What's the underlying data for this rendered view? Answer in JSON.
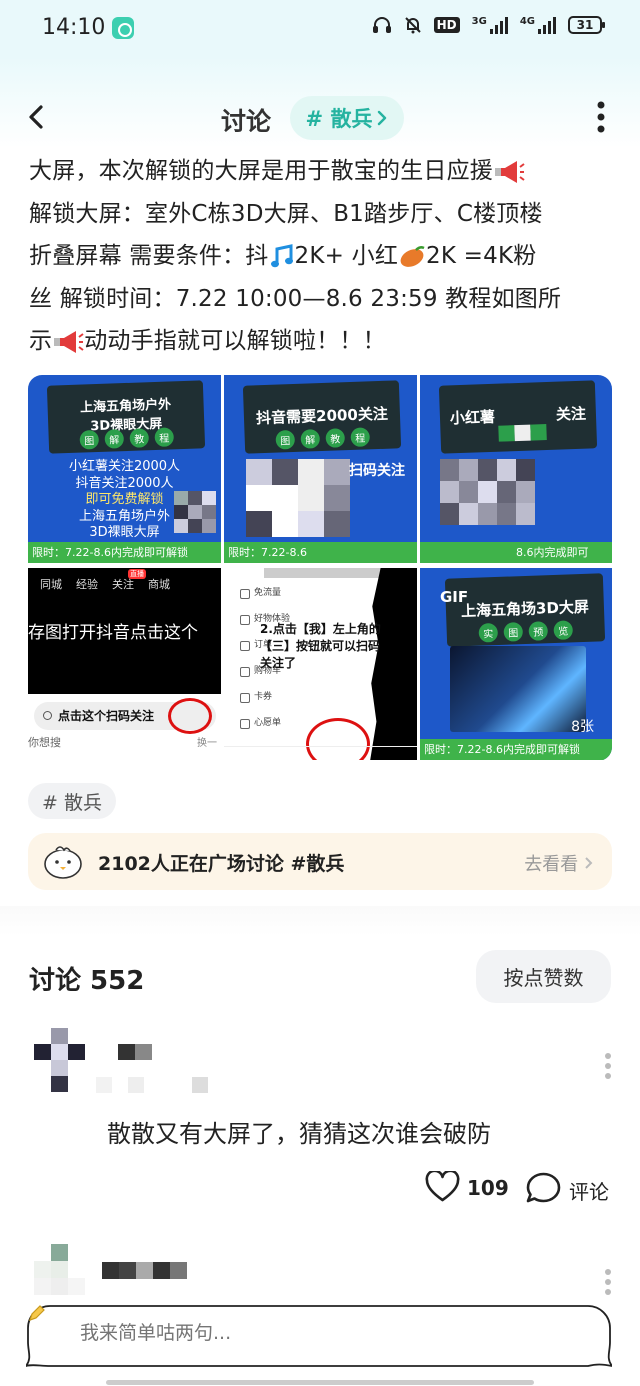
{
  "status_bar": {
    "time": "14:10",
    "hd_label": "HD",
    "net1": "3G",
    "net2": "4G",
    "battery": "31"
  },
  "header": {
    "title": "讨论",
    "topic_chip": "# 散兵"
  },
  "post": {
    "line1": "大屏，本次解锁的大屏是用于散宝的生日应援",
    "line2": "解锁大屏：室外C栋3D大屏、B1踏步厅、C楼顶楼",
    "line3_a": "折叠屏幕 需要条件：抖",
    "line3_b": "2K+ 小红",
    "line3_c": "2K =4K粉",
    "line4": "丝 解锁时间：7.22 10:00—8.6 23:59 教程如图所",
    "line5_a": "示",
    "line5_b": "动动手指就可以解锁啦！！！"
  },
  "images": {
    "tile1": {
      "title_l1": "上海五角场户外",
      "title_l2": "3D裸眼大屏",
      "chips": [
        "图",
        "解",
        "教",
        "程"
      ],
      "text_l1": "小红薯关注2000人",
      "text_l2": "抖音关注2000人",
      "text_l3": "即可免费解锁",
      "text_l4": "上海五角场户外",
      "text_l5": "3D裸眼大屏",
      "deadline": "限时：7.22-8.6内完成即可解锁"
    },
    "tile2": {
      "title": "抖音需要2000关注",
      "chips": [
        "图",
        "解",
        "教",
        "程"
      ],
      "scan": "扫码关注",
      "deadline": "限时：7.22-8.6"
    },
    "tile3": {
      "title_a": "小红薯",
      "title_b": "关注",
      "deadline": "8.6内完成即可"
    },
    "tile4": {
      "tabs": [
        "同城",
        "经验",
        "关注",
        "商城"
      ],
      "title": "存图打开抖音点击这个",
      "search": "点击这个扫码关注",
      "bottom": "你想搜",
      "bottom_right": "换一"
    },
    "tile5": {
      "menu": [
        "免流量",
        "好物体验",
        "订单",
        "购物车",
        "卡券",
        "心愿单"
      ],
      "step": "2.点击【我】左上角的【三】按钮就可以扫码关注了"
    },
    "tile6": {
      "gif": "GIF",
      "title": "上海五角场3D大屏",
      "chips": [
        "实",
        "图",
        "预",
        "览"
      ],
      "count": "8张",
      "deadline": "限时：7.22-8.6内完成即可解锁"
    }
  },
  "hashtag_chip": "# 散兵",
  "plaza": {
    "text": "2102人正在广场讨论 #散兵",
    "link": "去看看"
  },
  "comments": {
    "title": "讨论 552",
    "sort_button": "按点赞数",
    "items": [
      {
        "text": "散散又有大屏了，猜猜这次谁会破防",
        "likes": "109",
        "reply_label": "评论"
      }
    ]
  },
  "composer": {
    "placeholder": "我来简单咕两句..."
  }
}
